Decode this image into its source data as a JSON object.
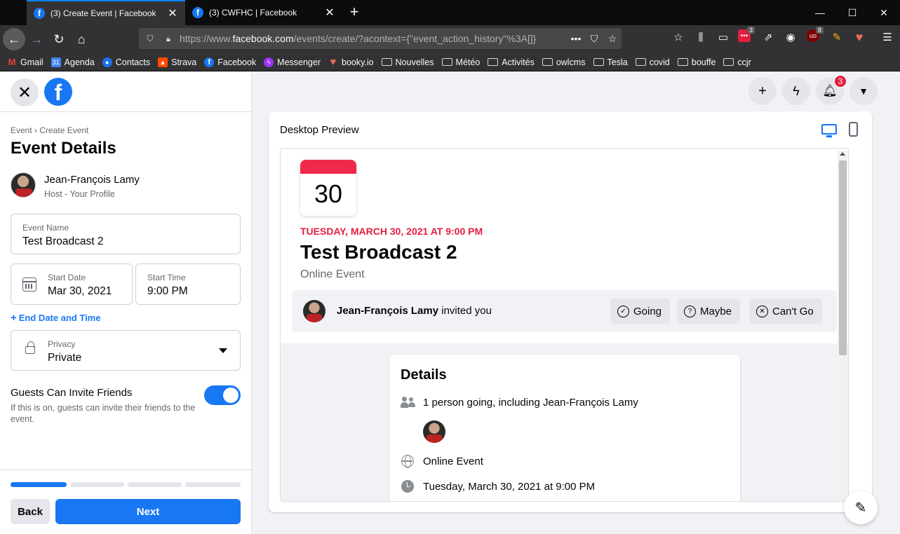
{
  "browser": {
    "tabs": [
      {
        "title": "(3) Create Event | Facebook",
        "active": true
      },
      {
        "title": "(3) CWFHC | Facebook",
        "active": false
      }
    ],
    "url_prefix": "https://www.",
    "url_host": "facebook.com",
    "url_rest": "/events/create/?acontext={\"event_action_history\"%3A[]}",
    "toolbar_badges": {
      "pocket_count": "3",
      "ublock_count": "8"
    },
    "bookmarks": [
      {
        "label": "Gmail",
        "icon": "gmail-icon",
        "color": "#ea4335"
      },
      {
        "label": "Agenda",
        "icon": "calendar-icon",
        "color": "#4285f4"
      },
      {
        "label": "Contacts",
        "icon": "contacts-icon",
        "color": "#1a73e8"
      },
      {
        "label": "Strava",
        "icon": "strava-icon",
        "color": "#fc4c02"
      },
      {
        "label": "Facebook",
        "icon": "facebook-icon",
        "color": "#1877f2"
      },
      {
        "label": "Messenger",
        "icon": "messenger-icon",
        "color": "#a033ff"
      },
      {
        "label": "booky.io",
        "icon": "heart-icon",
        "color": "#e8685a"
      },
      {
        "label": "Nouvelles",
        "icon": "folder-icon",
        "color": ""
      },
      {
        "label": "Météo",
        "icon": "folder-icon",
        "color": ""
      },
      {
        "label": "Activités",
        "icon": "folder-icon",
        "color": ""
      },
      {
        "label": "owlcms",
        "icon": "folder-icon",
        "color": ""
      },
      {
        "label": "Tesla",
        "icon": "folder-icon",
        "color": ""
      },
      {
        "label": "covid",
        "icon": "folder-icon",
        "color": ""
      },
      {
        "label": "bouffe",
        "icon": "folder-icon",
        "color": ""
      },
      {
        "label": "ccjr",
        "icon": "folder-icon",
        "color": ""
      }
    ]
  },
  "left": {
    "breadcrumb": "Event › Create Event",
    "title": "Event Details",
    "host_name": "Jean-François Lamy",
    "host_sub": "Host - Your Profile",
    "event_name_label": "Event Name",
    "event_name_value": "Test Broadcast 2",
    "start_date_label": "Start Date",
    "start_date_value": "Mar 30, 2021",
    "start_time_label": "Start Time",
    "start_time_value": "9:00 PM",
    "end_date_link": "End Date and Time",
    "privacy_label": "Privacy",
    "privacy_value": "Private",
    "guests_title": "Guests Can Invite Friends",
    "guests_desc": "If this is on, guests can invite their friends to the event.",
    "guests_toggle_on": true,
    "progress_steps": [
      true,
      false,
      false,
      false
    ],
    "back_label": "Back",
    "next_label": "Next"
  },
  "top_actions": {
    "notification_count": "3"
  },
  "preview": {
    "title": "Desktop Preview",
    "day": "30",
    "date_line": "TUESDAY, MARCH 30, 2021 AT 9:00 PM",
    "event_title": "Test Broadcast 2",
    "event_type": "Online Event",
    "inviter": "Jean-François Lamy",
    "invited_text": " invited you",
    "rsvp_going": "Going",
    "rsvp_maybe": "Maybe",
    "rsvp_cant": "Can't Go",
    "details_title": "Details",
    "details_going": "1 person going, including Jean-François Lamy",
    "details_online": "Online Event",
    "details_datetime": "Tuesday, March 30, 2021 at 9:00 PM"
  },
  "colors": {
    "brand": "#1877f2",
    "accent_red": "#e41e3f"
  }
}
